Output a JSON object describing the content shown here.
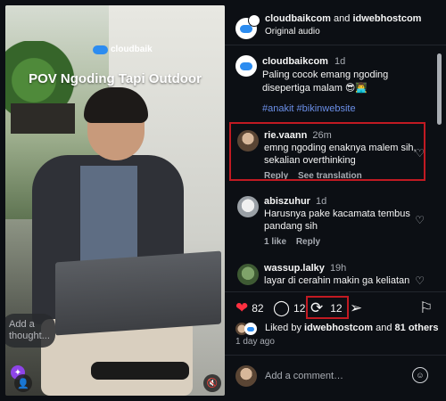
{
  "media": {
    "watermark": "cloudbaik",
    "title": "POV Ngoding Tapi Outdoor",
    "thought_placeholder": "Add a thought..."
  },
  "header": {
    "user1": "cloudbaikcom",
    "connector": "and",
    "user2": "idwebhostcom",
    "subtitle": "Original audio"
  },
  "caption": {
    "username": "cloudbaikcom",
    "time": "1d",
    "text_line1": "Paling cocok emang ngoding",
    "text_line2": "disepertiga malam 😎👨‍💻",
    "hashtags": "#anakit #bikinwebsite"
  },
  "comments": [
    {
      "username": "rie.vaann",
      "time": "26m",
      "line1": "emng ngoding enaknya malem sih,",
      "line2": "sekalian overthinking",
      "meta1": "Reply",
      "meta2": "See translation"
    },
    {
      "username": "abiszuhur",
      "time": "1d",
      "line1": "Harusnya pake kacamata tembus",
      "line2": "pandang sih",
      "meta1": "1 like",
      "meta2": "Reply"
    },
    {
      "username": "wassup.lalky",
      "time": "19h",
      "line1": "layar di cerahin makin ga keliatan",
      "line2": "",
      "meta1": "",
      "meta2": ""
    }
  ],
  "actions": {
    "likes_count": "82",
    "comments_count": "12",
    "reposts_count": "12"
  },
  "liked_by": {
    "prefix": "Liked by",
    "user": "idwebhostcom",
    "connector": "and",
    "others": "81 others"
  },
  "post_time": "1 day ago",
  "add_comment_placeholder": "Add a comment…",
  "colors": {
    "accent_like": "#ff3040",
    "highlight": "#c11a22",
    "hashtag": "#6b8fe8",
    "background": "#0c0f14"
  }
}
